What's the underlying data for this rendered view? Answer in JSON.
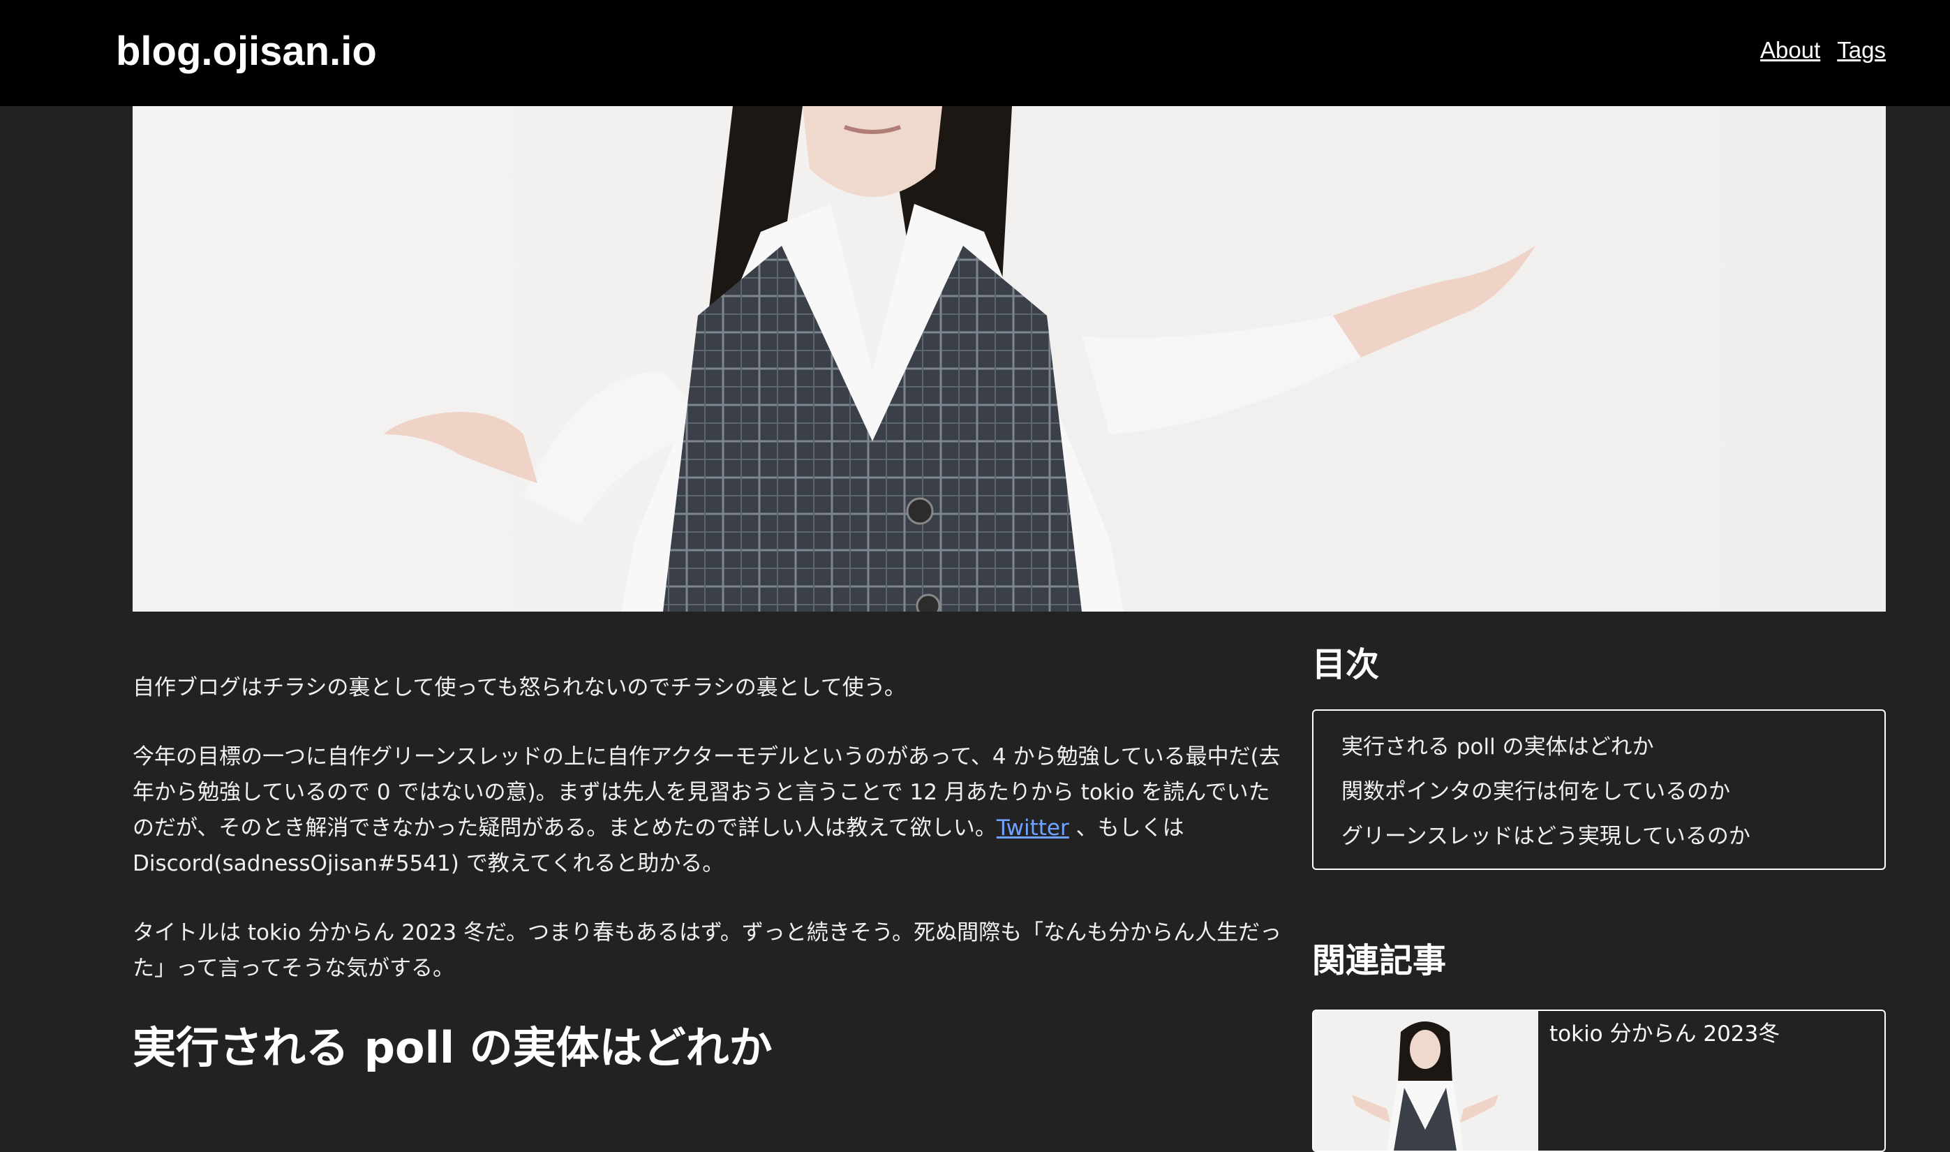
{
  "header": {
    "site_title": "blog.ojisan.io",
    "nav": [
      {
        "label": "About"
      },
      {
        "label": "Tags"
      }
    ]
  },
  "article": {
    "p1": "自作ブログはチラシの裏として使っても怒られないのでチラシの裏として使う。",
    "p2_before_link": "今年の目標の一つに自作グリーンスレッドの上に自作アクターモデルというのがあって、4 から勉強している最中だ(去年から勉強しているので 0 ではないの意)。まずは先人を見習おうと言うことで 12 月あたりから tokio を読んでいたのだが、そのとき解消できなかった疑問がある。まとめたので詳しい人は教えて欲しい。",
    "p2_link": "Twitter",
    "p2_after_link": " 、もしくは Discord(sadnessOjisan#5541) で教えてくれると助かる。",
    "p3": "タイトルは tokio 分からん 2023 冬だ。つまり春もあるはず。ずっと続きそう。死ぬ間際も「なんも分からん人生だった」って言ってそうな気がする。",
    "h2": "実行される poll の実体はどれか"
  },
  "sidebar": {
    "toc_heading": "目次",
    "toc_items": [
      "実行される poll の実体はどれか",
      "関数ポインタの実行は何をしているのか",
      "グリーンスレッドはどう実現しているのか"
    ],
    "related_heading": "関連記事",
    "related": [
      {
        "title": "tokio 分からん 2023冬"
      }
    ]
  },
  "colors": {
    "background": "#222222",
    "header": "#000000",
    "link": "#6fa3ff"
  }
}
